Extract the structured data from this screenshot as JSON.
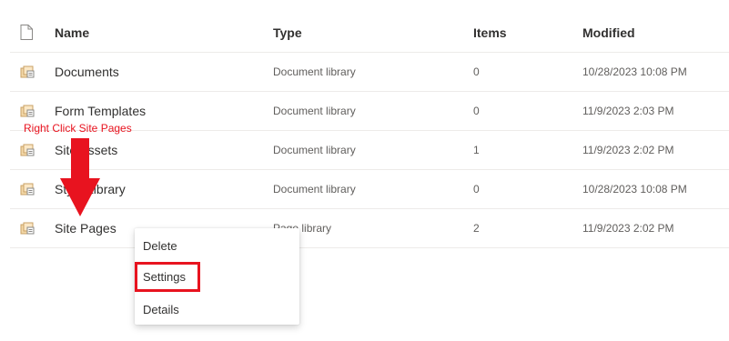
{
  "header": {
    "name": "Name",
    "type": "Type",
    "items": "Items",
    "modified": "Modified"
  },
  "rows": [
    {
      "name": "Documents",
      "type": "Document library",
      "items": "0",
      "modified": "10/28/2023 10:08 PM"
    },
    {
      "name": "Form Templates",
      "type": "Document library",
      "items": "0",
      "modified": "11/9/2023 2:03 PM"
    },
    {
      "name": "Site Assets",
      "type": "Document library",
      "items": "1",
      "modified": "11/9/2023 2:02 PM"
    },
    {
      "name": "Style Library",
      "type": "Document library",
      "items": "0",
      "modified": "10/28/2023 10:08 PM"
    },
    {
      "name": "Site Pages",
      "type": "Page library",
      "items": "2",
      "modified": "11/9/2023 2:02 PM"
    }
  ],
  "context_menu": {
    "items": [
      "Delete",
      "Settings",
      "Details"
    ]
  },
  "annotation": {
    "text": "Right Click Site Pages",
    "color": "#e8131f"
  },
  "icons": {
    "header": "file-icon",
    "row": "library-icon"
  }
}
